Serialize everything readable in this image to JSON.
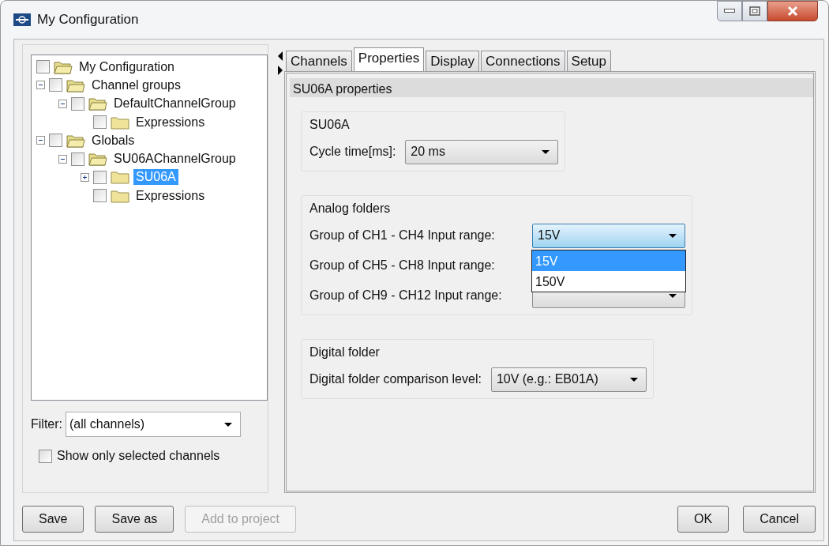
{
  "window": {
    "title": "My Configuration"
  },
  "tree": [
    {
      "label": "My Configuration",
      "kind": "root",
      "checked": false,
      "selected": false,
      "expanded": true,
      "children": [
        {
          "label": "Channel groups",
          "kind": "node",
          "checked": false,
          "selected": false,
          "expanded": true,
          "children": [
            {
              "label": "DefaultChannelGroup",
              "kind": "node",
              "checked": false,
              "selected": false,
              "expanded": true,
              "children": [
                {
                  "label": "Expressions",
                  "kind": "leaf",
                  "checked": false,
                  "selected": false
                }
              ]
            }
          ]
        },
        {
          "label": "Globals",
          "kind": "node",
          "checked": false,
          "selected": false,
          "expanded": true,
          "children": [
            {
              "label": "SU06AChannelGroup",
              "kind": "node",
              "checked": false,
              "selected": false,
              "expanded": true,
              "children": [
                {
                  "label": "SU06A",
                  "kind": "node",
                  "checked": false,
                  "selected": true,
                  "expanded": false
                },
                {
                  "label": "Expressions",
                  "kind": "leaf",
                  "checked": false,
                  "selected": false
                }
              ]
            }
          ]
        }
      ]
    }
  ],
  "filter": {
    "label": "Filter:",
    "value": "(all channels)"
  },
  "show_selected": {
    "label": "Show only selected channels",
    "checked": false
  },
  "tabs": [
    {
      "label": "Channels",
      "selected": false
    },
    {
      "label": "Properties",
      "selected": true
    },
    {
      "label": "Display",
      "selected": false
    },
    {
      "label": "Connections",
      "selected": false
    },
    {
      "label": "Setup",
      "selected": false
    }
  ],
  "properties": {
    "header": "SU06A properties",
    "groups": [
      {
        "title": "SU06A",
        "rows": [
          {
            "label": "Cycle time[ms]:",
            "value": "20 ms",
            "open": false
          }
        ]
      },
      {
        "title": "Analog folders",
        "rows": [
          {
            "label": "Group of CH1 - CH4 Input range:",
            "value": "15V",
            "open": true,
            "options": [
              {
                "label": "15V",
                "selected": true
              },
              {
                "label": "150V",
                "selected": false
              }
            ]
          },
          {
            "label": "Group of CH5 - CH8 Input range:"
          },
          {
            "label": "Group of CH9 - CH12 Input range:",
            "open": false
          }
        ]
      },
      {
        "title": "Digital folder",
        "rows": [
          {
            "label": "Digital folder comparison level:",
            "value": "10V (e.g.: EB01A)",
            "open": false
          }
        ]
      }
    ]
  },
  "buttons_left": [
    {
      "label": "Save",
      "disabled": false
    },
    {
      "label": "Save as",
      "disabled": false
    },
    {
      "label": "Add to project",
      "disabled": true
    }
  ],
  "buttons_right": [
    {
      "label": "OK",
      "disabled": false
    },
    {
      "label": "Cancel",
      "disabled": false
    }
  ]
}
